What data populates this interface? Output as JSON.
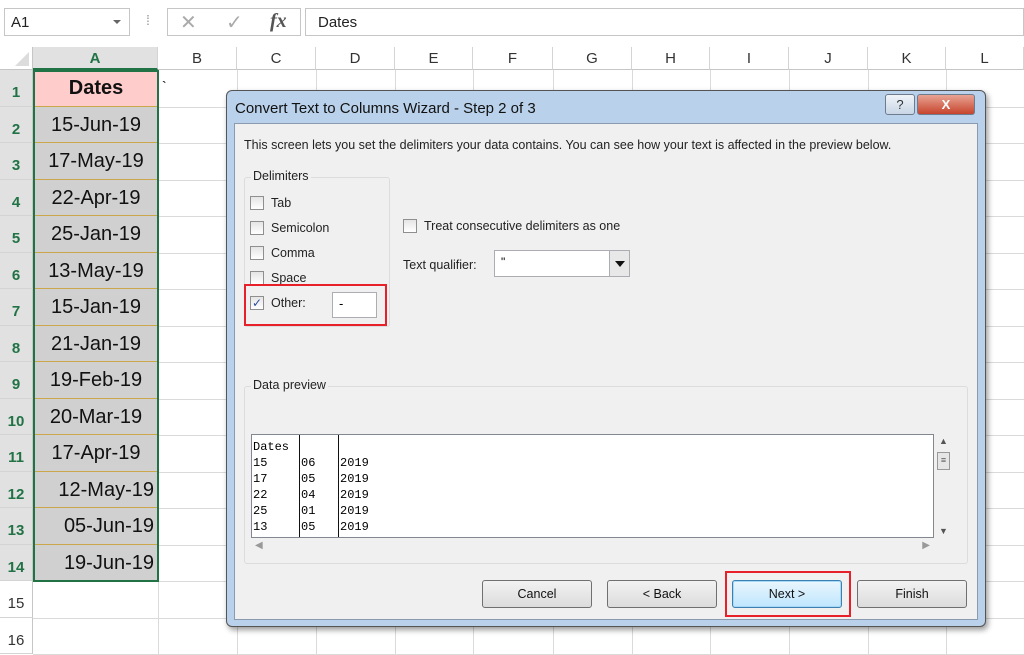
{
  "formula_bar": {
    "name_box": "A1",
    "cancel_icon": "x-icon",
    "enter_icon": "check-icon",
    "fx_label": "fx",
    "formula": "Dates"
  },
  "sheet": {
    "columns": [
      "A",
      "B",
      "C",
      "D",
      "E",
      "F",
      "G",
      "H",
      "I",
      "J",
      "K",
      "L"
    ],
    "rows": [
      "1",
      "2",
      "3",
      "4",
      "5",
      "6",
      "7",
      "8",
      "9",
      "10",
      "11",
      "12",
      "13",
      "14",
      "15",
      "16"
    ],
    "column_a": [
      "Dates",
      "15-Jun-19",
      "17-May-19",
      "22-Apr-19",
      "25-Jan-19",
      "13-May-19",
      "15-Jan-19",
      "21-Jan-19",
      "19-Feb-19",
      "20-Mar-19",
      "17-Apr-19",
      "12-May-19",
      "05-Jun-19",
      "19-Jun-19"
    ],
    "b1_mark": "`",
    "header_fill": "#ffcccc",
    "cell_fill": "#d0d0d0",
    "selection_color": "#217346"
  },
  "dialog": {
    "title_prefix": "Convert Text to Columns Wizard - ",
    "title_step": "Step 2 of 3",
    "help": "?",
    "close": "X",
    "description": "This screen lets you set the delimiters your data contains.  You can see how your text is affected in the preview below.",
    "delimiters_label": "Delimiters",
    "delimiters": [
      {
        "label": "Tab",
        "checked": false
      },
      {
        "label": "Semicolon",
        "checked": false
      },
      {
        "label": "Comma",
        "checked": false
      },
      {
        "label": "Space",
        "checked": false
      },
      {
        "label": "Other:",
        "checked": true
      }
    ],
    "other_value": "-",
    "treat_consecutive": {
      "label": "Treat consecutive delimiters as one",
      "checked": false
    },
    "text_qualifier_label": "Text qualifier:",
    "text_qualifier_value": "\"",
    "preview_label": "Data preview",
    "preview_rows": [
      [
        "Dates",
        "",
        ""
      ],
      [
        "15",
        "06",
        "2019"
      ],
      [
        "17",
        "05",
        "2019"
      ],
      [
        "22",
        "04",
        "2019"
      ],
      [
        "25",
        "01",
        "2019"
      ],
      [
        "13",
        "05",
        "2019"
      ]
    ],
    "buttons": {
      "cancel": "Cancel",
      "back": "< Back",
      "next": "Next >",
      "finish": "Finish"
    },
    "highlight_color": "#e8202a"
  }
}
